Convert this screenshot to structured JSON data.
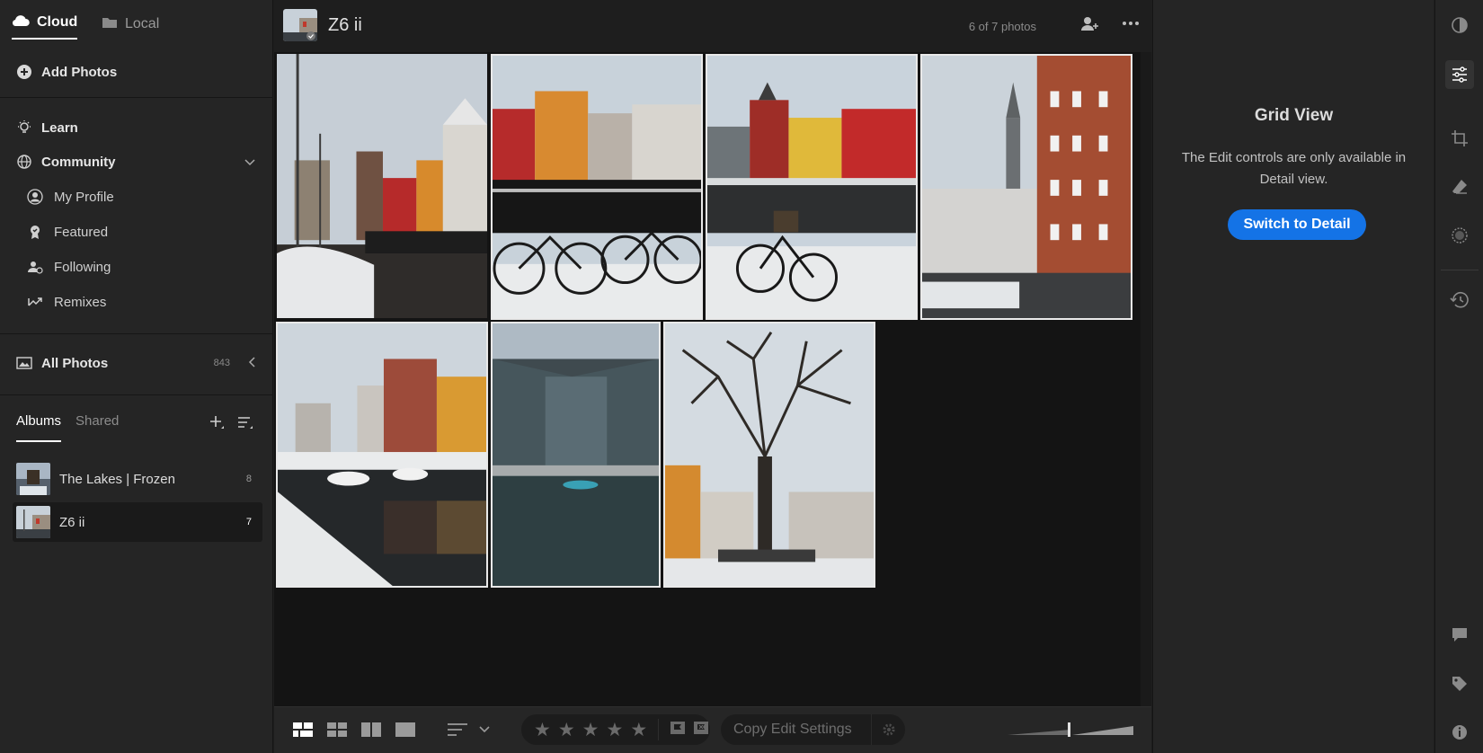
{
  "sidebar": {
    "tabs": [
      {
        "label": "Cloud"
      },
      {
        "label": "Local"
      }
    ],
    "add_photos": "Add Photos",
    "learn": "Learn",
    "community": "Community",
    "community_items": [
      {
        "label": "My Profile",
        "icon": "person-icon"
      },
      {
        "label": "Featured",
        "icon": "badge-icon"
      },
      {
        "label": "Following",
        "icon": "following-icon"
      },
      {
        "label": "Remixes",
        "icon": "remix-icon"
      }
    ],
    "all_photos": {
      "label": "All Photos",
      "count": "843"
    },
    "album_tabs": [
      {
        "label": "Albums"
      },
      {
        "label": "Shared"
      }
    ],
    "albums": [
      {
        "label": "The Lakes | Frozen",
        "count": "8"
      },
      {
        "label": "Z6 ii",
        "count": "7"
      }
    ]
  },
  "center": {
    "album_title": "Z6 ii",
    "photo_count": "6 of 7 photos",
    "photos": [
      {
        "subject": "Nyhavn harbour with sailboat mast and colourful houses"
      },
      {
        "subject": "Snowy bicycles in front of colourful houses and boat"
      },
      {
        "subject": "Single bicycle in snow by canal with red and yellow houses"
      },
      {
        "subject": "Red brick building and church spire in snow"
      },
      {
        "subject": "Canal with boats and reflections of houses"
      },
      {
        "subject": "Glass building by snowy harbour"
      },
      {
        "subject": "Bare tree in snowy square"
      }
    ],
    "bottom": {
      "copy_edit_settings": "Copy Edit Settings"
    }
  },
  "right_panel": {
    "title": "Grid View",
    "message": "The Edit controls are only available in Detail view.",
    "button": "Switch to Detail"
  },
  "colors": {
    "accent": "#1473e6",
    "panel": "#252525",
    "grid_bg": "#141414"
  }
}
